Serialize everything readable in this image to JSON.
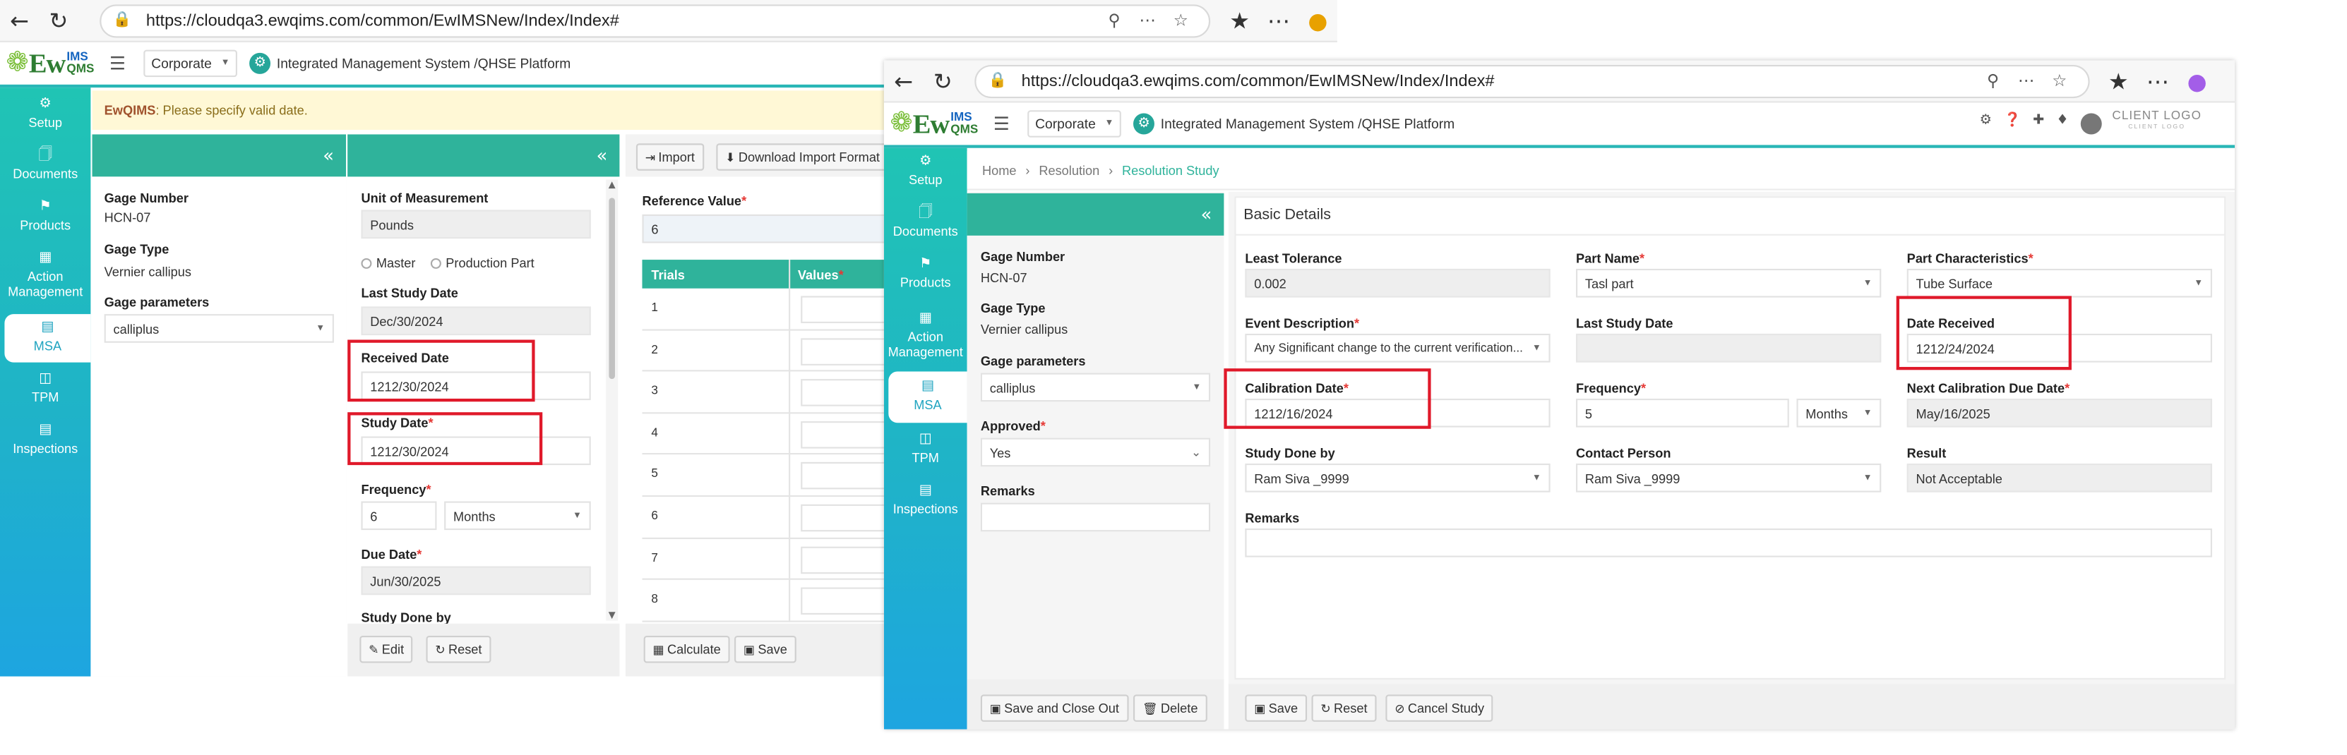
{
  "bg_window": {
    "url": "https://cloudqa3.ewqims.com/common/EwIMSNew/Index/Index#",
    "corporate": "Corporate",
    "platform": "Integrated Management System /QHSE Platform",
    "alert_brand": "EwQIMS",
    "alert_text": " : Please specify valid date.",
    "sidebar": [
      "Setup",
      "Documents",
      "Products",
      "Action Management",
      "MSA",
      "TPM",
      "Inspections"
    ],
    "left_panel": {
      "gage_number_label": "Gage Number",
      "gage_number": "HCN-07",
      "gage_type_label": "Gage Type",
      "gage_type": "Vernier callipus",
      "gage_params_label": "Gage parameters",
      "gage_params": "calliplus"
    },
    "mid_panel": {
      "uom_label": "Unit of Measurement",
      "uom": "Pounds",
      "radio_master": "Master",
      "radio_production": "Production Part",
      "last_study_label": "Last Study Date",
      "last_study": "Dec/30/2024",
      "received_label": "Received Date",
      "received": "1212/30/2024",
      "study_label": "Study Date",
      "study": "1212/30/2024",
      "frequency_label": "Frequency",
      "frequency": "6",
      "frequency_unit": "Months",
      "due_label": "Due Date",
      "due": "Jun/30/2025",
      "study_done_label": "Study Done by",
      "edit": "Edit",
      "reset": "Reset"
    },
    "right_panel": {
      "import": "Import",
      "download": "Download Import Format",
      "ref_label": "Reference Value",
      "ref_value": "6",
      "col_trials": "Trials",
      "col_values": "Values",
      "trials": [
        "1",
        "2",
        "3",
        "4",
        "5",
        "6",
        "7",
        "8"
      ],
      "calculate": "Calculate",
      "save": "Save"
    }
  },
  "fg_window": {
    "url": "https://cloudqa3.ewqims.com/common/EwIMSNew/Index/Index#",
    "corporate": "Corporate",
    "platform": "Integrated Management System /QHSE Platform",
    "client_logo": "CLIENT LOGO",
    "client_logo_sub": "CLIENT LOGO",
    "breadcrumb": [
      "Home",
      "Resolution",
      "Resolution Study"
    ],
    "sidebar": [
      "Setup",
      "Documents",
      "Products",
      "Action Management",
      "MSA",
      "TPM",
      "Inspections"
    ],
    "left_panel": {
      "gage_number_label": "Gage Number",
      "gage_number": "HCN-07",
      "gage_type_label": "Gage Type",
      "gage_type": "Vernier callipus",
      "gage_params_label": "Gage parameters",
      "gage_params": "calliplus",
      "approved_label": "Approved",
      "approved": "Yes",
      "remarks_label": "Remarks",
      "save_close": "Save and Close Out",
      "delete": "Delete"
    },
    "details": {
      "title": "Basic Details",
      "least_tol_label": "Least Tolerance",
      "least_tol": "0.002",
      "part_name_label": "Part Name",
      "part_name": "Tasl part",
      "part_char_label": "Part Characteristics",
      "part_char": "Tube Surface",
      "event_label": "Event Description",
      "event": "Any Significant change to the current verification...",
      "last_study_label": "Last Study Date",
      "last_study": "",
      "date_received_label": "Date Received",
      "date_received": "1212/24/2024",
      "cal_date_label": "Calibration Date",
      "cal_date": "1212/16/2024",
      "frequency_label": "Frequency",
      "frequency": "5",
      "frequency_unit": "Months",
      "next_cal_label": "Next Calibration Due Date",
      "next_cal": "May/16/2025",
      "study_done_label": "Study Done by",
      "study_done": "Ram Siva _9999",
      "contact_label": "Contact Person",
      "contact": "Ram Siva _9999",
      "result_label": "Result",
      "result": "Not Acceptable",
      "remarks_label": "Remarks",
      "save": "Save",
      "reset": "Reset",
      "cancel": "Cancel Study"
    }
  },
  "colors": {
    "accent": "#2fb39b",
    "highlight": "#e0192a",
    "alert_bg": "#fff8d6"
  }
}
